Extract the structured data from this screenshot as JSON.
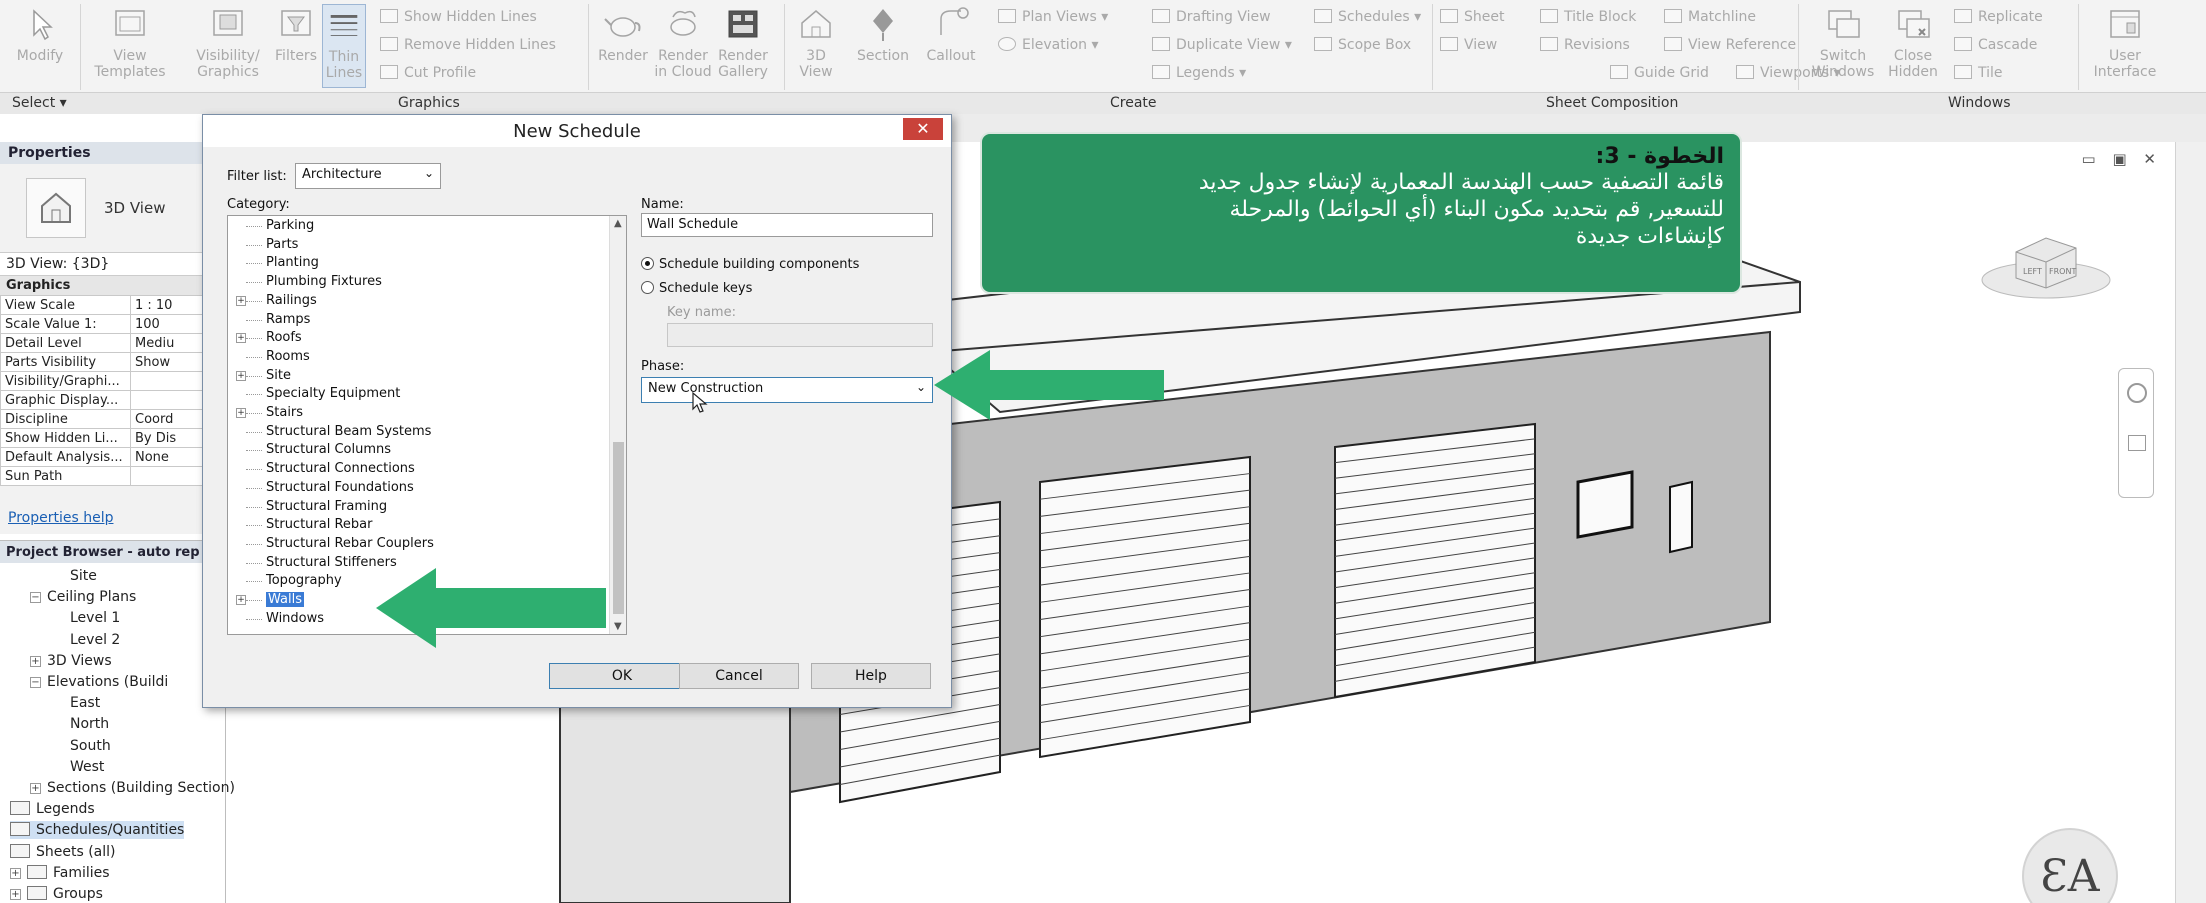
{
  "ribbon": {
    "buttons": [
      {
        "id": "modify",
        "label_line1": "",
        "label_line2": "Modify"
      },
      {
        "id": "view-templates",
        "label_line1": "View",
        "label_line2": "Templates"
      },
      {
        "id": "visibility-graphics",
        "label_line1": "Visibility/",
        "label_line2": "Graphics"
      },
      {
        "id": "filters",
        "label_line1": "Filters",
        "label_line2": ""
      },
      {
        "id": "thin-lines",
        "label_line1": "Thin",
        "label_line2": "Lines"
      },
      {
        "id": "render",
        "label_line1": "Render",
        "label_line2": ""
      },
      {
        "id": "render-cloud",
        "label_line1": "Render",
        "label_line2": "in Cloud"
      },
      {
        "id": "render-gallery",
        "label_line1": "Render",
        "label_line2": "Gallery"
      },
      {
        "id": "3d-view",
        "label_line1": "3D",
        "label_line2": "View"
      },
      {
        "id": "section",
        "label_line1": "Section",
        "label_line2": ""
      },
      {
        "id": "callout",
        "label_line1": "Callout",
        "label_line2": ""
      },
      {
        "id": "switch-windows",
        "label_line1": "Switch",
        "label_line2": "Windows"
      },
      {
        "id": "close-hidden",
        "label_line1": "Close",
        "label_line2": "Hidden"
      },
      {
        "id": "user-interface",
        "label_line1": "User",
        "label_line2": "Interface"
      }
    ],
    "small": {
      "show_hidden_lines": "Show  Hidden Lines",
      "remove_hidden_lines": "Remove  Hidden Lines",
      "cut_profile": "Cut  Profile",
      "plan_views": "Plan  Views",
      "elevation": "Elevation",
      "drafting_view": "Drafting  View",
      "duplicate_view": "Duplicate  View",
      "legends": "Legends",
      "schedules": "Schedules",
      "scope_box": "Scope  Box",
      "sheet": "Sheet",
      "view": "View",
      "title_block": "Title  Block",
      "revisions": "Revisions",
      "guide_grid": "Guide  Grid",
      "matchline": "Matchline",
      "view_reference": "View  Reference",
      "viewports": "Viewports",
      "replicate": "Replicate",
      "cascade": "Cascade",
      "tile": "Tile"
    },
    "panel_titles": {
      "select": "Select",
      "graphics": "Graphics",
      "create": "Create",
      "sheet_composition": "Sheet Composition",
      "windows": "Windows"
    }
  },
  "properties": {
    "title": "Properties",
    "type_name": "3D View",
    "view_id": "3D View: {3D}",
    "group": "Graphics",
    "rows": [
      {
        "k": "View Scale",
        "v": "1 : 10"
      },
      {
        "k": "Scale Value  1:",
        "v": "100"
      },
      {
        "k": "Detail Level",
        "v": "Mediu"
      },
      {
        "k": "Parts Visibility",
        "v": "Show"
      },
      {
        "k": "Visibility/Graphi...",
        "v": ""
      },
      {
        "k": "Graphic Display...",
        "v": ""
      },
      {
        "k": "Discipline",
        "v": "Coord"
      },
      {
        "k": "Show Hidden Li...",
        "v": "By Dis"
      },
      {
        "k": "Default Analysis...",
        "v": "None"
      },
      {
        "k": "Sun Path",
        "v": ""
      }
    ],
    "help": "Properties help"
  },
  "project_browser": {
    "title": "Project Browser - auto rep",
    "items": [
      {
        "label": "Site",
        "indent": 3,
        "toggle": ""
      },
      {
        "label": "Ceiling Plans",
        "indent": 1,
        "toggle": "−"
      },
      {
        "label": "Level 1",
        "indent": 3,
        "toggle": ""
      },
      {
        "label": "Level 2",
        "indent": 3,
        "toggle": ""
      },
      {
        "label": "3D Views",
        "indent": 1,
        "toggle": "+"
      },
      {
        "label": "Elevations (Buildi",
        "indent": 1,
        "toggle": "−"
      },
      {
        "label": "East",
        "indent": 3,
        "toggle": ""
      },
      {
        "label": "North",
        "indent": 3,
        "toggle": ""
      },
      {
        "label": "South",
        "indent": 3,
        "toggle": ""
      },
      {
        "label": "West",
        "indent": 3,
        "toggle": ""
      },
      {
        "label": "Sections (Building Section)",
        "indent": 1,
        "toggle": "+"
      },
      {
        "label": "Legends",
        "indent": 0,
        "toggle": "",
        "icon": true
      },
      {
        "label": "Schedules/Quantities",
        "indent": 0,
        "toggle": "",
        "icon": true,
        "selected": true
      },
      {
        "label": "Sheets (all)",
        "indent": 0,
        "toggle": "",
        "icon": true
      },
      {
        "label": "Families",
        "indent": 0,
        "toggle": "+",
        "icon": true
      },
      {
        "label": "Groups",
        "indent": 0,
        "toggle": "+",
        "icon": true
      }
    ]
  },
  "dialog": {
    "title": "New Schedule",
    "close": "✕",
    "filter_label": "Filter list:",
    "filter_value": "Architecture",
    "category_label": "Category:",
    "categories": [
      {
        "label": "Parking",
        "toggle": ""
      },
      {
        "label": "Parts",
        "toggle": ""
      },
      {
        "label": "Planting",
        "toggle": ""
      },
      {
        "label": "Plumbing Fixtures",
        "toggle": ""
      },
      {
        "label": "Railings",
        "toggle": "+"
      },
      {
        "label": "Ramps",
        "toggle": ""
      },
      {
        "label": "Roofs",
        "toggle": "+"
      },
      {
        "label": "Rooms",
        "toggle": ""
      },
      {
        "label": "Site",
        "toggle": "+"
      },
      {
        "label": "Specialty Equipment",
        "toggle": ""
      },
      {
        "label": "Stairs",
        "toggle": "+"
      },
      {
        "label": "Structural Beam Systems",
        "toggle": ""
      },
      {
        "label": "Structural Columns",
        "toggle": ""
      },
      {
        "label": "Structural Connections",
        "toggle": ""
      },
      {
        "label": "Structural Foundations",
        "toggle": ""
      },
      {
        "label": "Structural Framing",
        "toggle": ""
      },
      {
        "label": "Structural Rebar",
        "toggle": ""
      },
      {
        "label": "Structural Rebar Couplers",
        "toggle": ""
      },
      {
        "label": "Structural Stiffeners",
        "toggle": ""
      },
      {
        "label": "Topography",
        "toggle": ""
      },
      {
        "label": "Walls",
        "toggle": "+",
        "selected": true
      },
      {
        "label": "Windows",
        "toggle": ""
      }
    ],
    "name_label": "Name:",
    "name_value": "Wall Schedule",
    "radio_components": "Schedule building components",
    "radio_keys": "Schedule keys",
    "key_name_label": "Key name:",
    "phase_label": "Phase:",
    "phase_value": "New Construction",
    "ok": "OK",
    "cancel": "Cancel",
    "help": "Help"
  },
  "callout": {
    "title": "الخطوة - 3:",
    "line1": "قائمة التصفية حسب الهندسة المعمارية لإنشاء جدول جديد",
    "line2": "للتسعير, قم بتحديد مكون البناء (أي الحوائط) والمرحلة",
    "line3": "كإنشاءات جديدة"
  },
  "viewcube": {
    "left": "LEFT",
    "front": "FRONT"
  },
  "window_controls": "▭ ▣ ✕",
  "colors": {
    "annotation_green": "#2a9361",
    "selection_blue": "#3a7bd5",
    "close_red": "#c9423a"
  }
}
